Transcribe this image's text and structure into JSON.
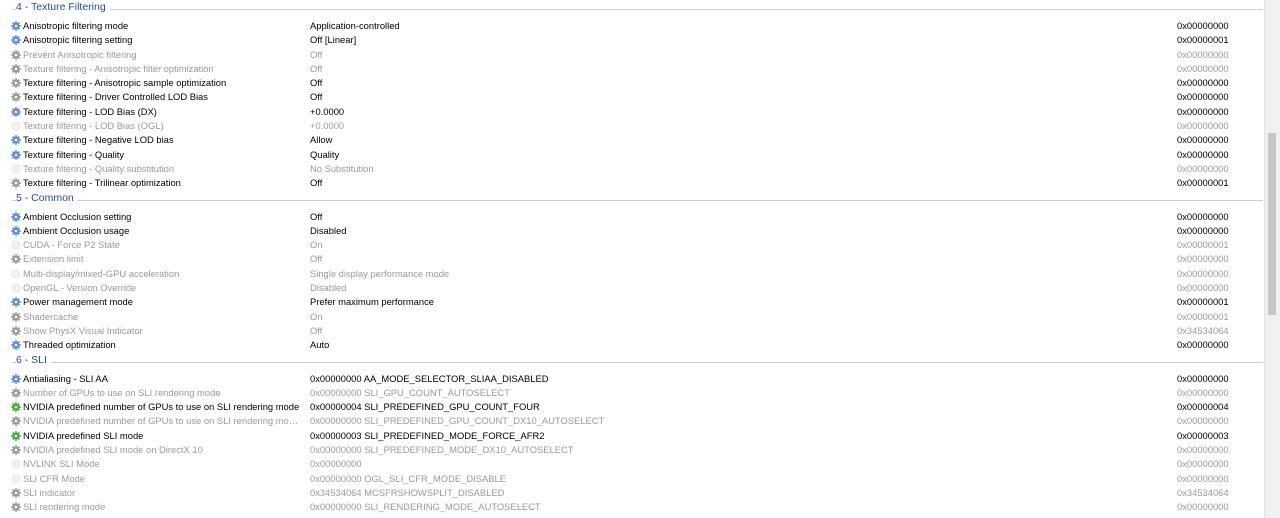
{
  "sections": [
    {
      "title": "4 - Texture Filtering",
      "rows": [
        {
          "name": "Anisotropic filtering mode",
          "value": "Application-controlled",
          "hex": "0x00000000",
          "state": "blue"
        },
        {
          "name": "Anisotropic filtering setting",
          "value": "Off [Linear]",
          "hex": "0x00000001",
          "state": "blue"
        },
        {
          "name": "Prevent Anisotropic filtering",
          "value": "Off",
          "hex": "0x00000000",
          "state": "grey"
        },
        {
          "name": "Texture filtering - Anisotropic filter optimization",
          "value": "Off",
          "hex": "0x00000000",
          "state": "grey"
        },
        {
          "name": "Texture filtering - Anisotropic sample optimization",
          "value": "Off",
          "hex": "0x00000000",
          "state": "grey-active"
        },
        {
          "name": "Texture filtering - Driver Controlled LOD Bias",
          "value": "Off",
          "hex": "0x00000000",
          "state": "grey-active"
        },
        {
          "name": "Texture filtering - LOD Bias (DX)",
          "value": "+0.0000",
          "hex": "0x00000000",
          "state": "blue"
        },
        {
          "name": "Texture filtering - LOD Bias (OGL)",
          "value": "+0.0000",
          "hex": "0x00000000",
          "state": "none"
        },
        {
          "name": "Texture filtering - Negative LOD bias",
          "value": "Allow",
          "hex": "0x00000000",
          "state": "blue"
        },
        {
          "name": "Texture filtering - Quality",
          "value": "Quality",
          "hex": "0x00000000",
          "state": "blue"
        },
        {
          "name": "Texture filtering - Quality substitution",
          "value": "No Substitution",
          "hex": "0x00000000",
          "state": "none"
        },
        {
          "name": "Texture filtering - Trilinear optimization",
          "value": "Off",
          "hex": "0x00000001",
          "state": "grey-active"
        }
      ]
    },
    {
      "title": "5 - Common",
      "rows": [
        {
          "name": "Ambient Occlusion setting",
          "value": "Off",
          "hex": "0x00000000",
          "state": "blue"
        },
        {
          "name": "Ambient Occlusion usage",
          "value": "Disabled",
          "hex": "0x00000000",
          "state": "blue"
        },
        {
          "name": "CUDA - Force P2 State",
          "value": "On",
          "hex": "0x00000001",
          "state": "none"
        },
        {
          "name": "Extension limit",
          "value": "Off",
          "hex": "0x00000000",
          "state": "grey"
        },
        {
          "name": "Multi-display/mixed-GPU acceleration",
          "value": "Single display performance mode",
          "hex": "0x00000000",
          "state": "none"
        },
        {
          "name": "OpenGL - Version Override",
          "value": "Disabled",
          "hex": "0x00000000",
          "state": "none"
        },
        {
          "name": "Power management mode",
          "value": "Prefer maximum performance",
          "hex": "0x00000001",
          "state": "blue"
        },
        {
          "name": "Shadercache",
          "value": "On",
          "hex": "0x00000001",
          "state": "grey"
        },
        {
          "name": "Show PhysX Visual Indicator",
          "value": "Off",
          "hex": "0x34534064",
          "state": "grey"
        },
        {
          "name": "Threaded optimization",
          "value": "Auto",
          "hex": "0x00000000",
          "state": "blue"
        }
      ]
    },
    {
      "title": "6 - SLI",
      "rows": [
        {
          "name": "Antialiasing - SLI AA",
          "value": "0x00000000 AA_MODE_SELECTOR_SLIAA_DISABLED",
          "hex": "0x00000000",
          "state": "blue"
        },
        {
          "name": "Number of GPUs to use on SLI rendering mode",
          "value": "0x00000000 SLI_GPU_COUNT_AUTOSELECT",
          "hex": "0x00000000",
          "state": "grey"
        },
        {
          "name": "NVIDIA predefined number of GPUs to use on SLI rendering mode",
          "value": "0x00000004 SLI_PREDEFINED_GPU_COUNT_FOUR",
          "hex": "0x00000004",
          "state": "green"
        },
        {
          "name": "NVIDIA predefined number of GPUs to use on SLI rendering mode o...",
          "value": "0x00000000 SLI_PREDEFINED_GPU_COUNT_DX10_AUTOSELECT",
          "hex": "0x00000000",
          "state": "grey"
        },
        {
          "name": "NVIDIA predefined SLI mode",
          "value": "0x00000003 SLI_PREDEFINED_MODE_FORCE_AFR2",
          "hex": "0x00000003",
          "state": "green"
        },
        {
          "name": "NVIDIA predefined SLI mode on DirectX 10",
          "value": "0x00000000 SLI_PREDEFINED_MODE_DX10_AUTOSELECT",
          "hex": "0x00000000",
          "state": "grey"
        },
        {
          "name": "NVLINK SLI Mode",
          "value": "0x00000000",
          "hex": "0x00000000",
          "state": "none"
        },
        {
          "name": "SLI CFR Mode",
          "value": "0x00000000 OGL_SLI_CFR_MODE_DISABLE",
          "hex": "0x00000000",
          "state": "none"
        },
        {
          "name": "SLI indicator",
          "value": "0x34534064 MCSFRSHOWSPLIT_DISABLED",
          "hex": "0x34534064",
          "state": "grey"
        },
        {
          "name": "SLI rendering mode",
          "value": "0x00000000 SLI_RENDERING_MODE_AUTOSELECT",
          "hex": "0x00000000",
          "state": "grey"
        }
      ]
    }
  ],
  "colors": {
    "blue": "#5b8fd6",
    "grey": "#9a9a9a",
    "green": "#3fae3a",
    "section": "#1f4e9a",
    "dimText": "#9a9a9a"
  }
}
